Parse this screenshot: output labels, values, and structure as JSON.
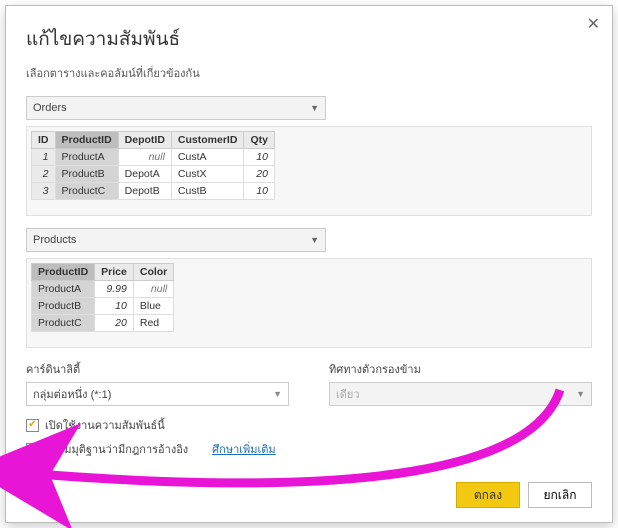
{
  "dialog": {
    "title": "แก้ไขความสัมพันธ์",
    "subtitle": "เลือกตารางและคอลัมน์ที่เกี่ยวข้องกัน"
  },
  "table1": {
    "name": "Orders",
    "columns": [
      "ID",
      "ProductID",
      "DepotID",
      "CustomerID",
      "Qty"
    ],
    "selectedCol": "ProductID",
    "rows": [
      {
        "ID": "1",
        "ProductID": "ProductA",
        "DepotID": "null",
        "CustomerID": "CustA",
        "Qty": "10"
      },
      {
        "ID": "2",
        "ProductID": "ProductB",
        "DepotID": "DepotA",
        "CustomerID": "CustX",
        "Qty": "20"
      },
      {
        "ID": "3",
        "ProductID": "ProductC",
        "DepotID": "DepotB",
        "CustomerID": "CustB",
        "Qty": "10"
      }
    ]
  },
  "table2": {
    "name": "Products",
    "columns": [
      "ProductID",
      "Price",
      "Color"
    ],
    "selectedCol": "ProductID",
    "rows": [
      {
        "ProductID": "ProductA",
        "Price": "9.99",
        "Color": "null"
      },
      {
        "ProductID": "ProductB",
        "Price": "10",
        "Color": "Blue"
      },
      {
        "ProductID": "ProductC",
        "Price": "20",
        "Color": "Red"
      }
    ]
  },
  "cardinality": {
    "label": "คาร์ดินาลิตี้",
    "value": "กลุ่มต่อหนึ่ง (*:1)"
  },
  "crossfilter": {
    "label": "ทิศทางตัวกรองข้าม",
    "value": "เดียว"
  },
  "checkboxes": {
    "active": {
      "label": "เปิดใช้งานความสัมพันธ์นี้",
      "checked": true
    },
    "assume": {
      "label": "ตั้งสมมุติฐานว่ามีกฎการอ้างอิง",
      "checked": false
    }
  },
  "link": "ศึกษาเพิ่มเติม",
  "buttons": {
    "ok": "ตกลง",
    "cancel": "ยกเลิก"
  }
}
